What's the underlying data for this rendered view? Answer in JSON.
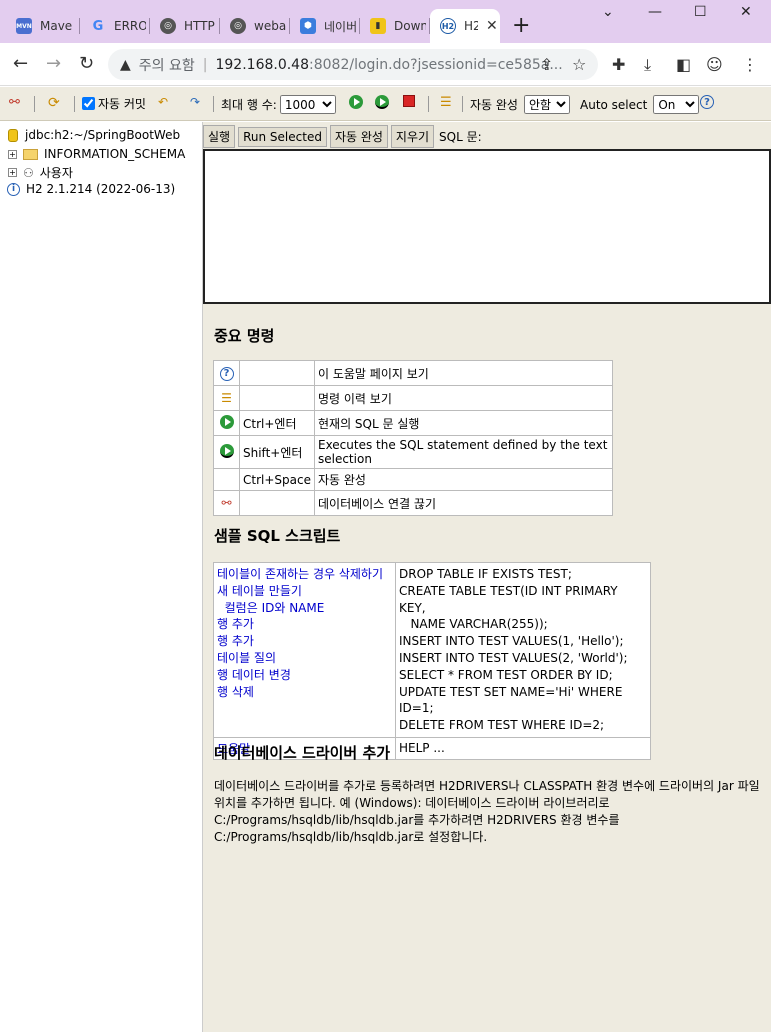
{
  "browser": {
    "tabs": [
      {
        "label": "Maven",
        "favicon": "maven-favicon"
      },
      {
        "label": "ERROR",
        "favicon": "google-favicon"
      },
      {
        "label": "HTTP",
        "favicon": "globe-favicon"
      },
      {
        "label": "webapp",
        "favicon": "globe-favicon"
      },
      {
        "label": "네이버",
        "favicon": "hex-favicon"
      },
      {
        "label": "Download",
        "favicon": "doc-favicon"
      },
      {
        "label": "H2",
        "favicon": "h2-favicon"
      }
    ],
    "address": {
      "warning": "주의 요함",
      "host": "192.168.0.48",
      "path": ":8082/login.do?jsessionid=ce585a..."
    }
  },
  "toolbar": {
    "autocommit_label": "자동 커밋",
    "maxrows_label": "최대 행 수:",
    "maxrows_value": "1000",
    "autocomplete_label": "자동 완성",
    "autocomplete_value": "안함",
    "autoselect_label": "Auto select",
    "autoselect_value": "On"
  },
  "tree": {
    "connection": "jdbc:h2:~/SpringBootWeb",
    "schema": "INFORMATION_SCHEMA",
    "users": "사용자",
    "version": "H2 2.1.214 (2022-06-13)"
  },
  "main": {
    "buttons": {
      "run": "실행",
      "run_selected": "Run Selected",
      "autocomplete": "자동 완성",
      "clear": "지우기"
    },
    "sql_label": "SQL 문:",
    "important_title": "중요 명령",
    "commands": [
      {
        "key": "",
        "desc": "이 도움말 페이지 보기"
      },
      {
        "key": "",
        "desc": "명령 이력 보기"
      },
      {
        "key": "Ctrl+엔터",
        "desc": "현재의 SQL 문 실행"
      },
      {
        "key": "Shift+엔터",
        "desc": "Executes the SQL statement defined by the text selection"
      },
      {
        "key": "Ctrl+Space",
        "desc": "자동 완성"
      },
      {
        "key": "",
        "desc": "데이터베이스 연결 끊기"
      }
    ],
    "sample_title": "샘플 SQL 스크립트",
    "samples": [
      {
        "label": "테이블이 존재하는 경우 삭제하기",
        "sql": "DROP TABLE IF EXISTS TEST;"
      },
      {
        "label": "새 테이블 만들기",
        "sql": "CREATE TABLE TEST(ID INT PRIMARY KEY,"
      },
      {
        "label": "  컬럼은 ID와 NAME",
        "sql": "   NAME VARCHAR(255));"
      },
      {
        "label": "행 추가",
        "sql": "INSERT INTO TEST VALUES(1, 'Hello');"
      },
      {
        "label": "행 추가",
        "sql": "INSERT INTO TEST VALUES(2, 'World');"
      },
      {
        "label": "테이블 질의",
        "sql": "SELECT * FROM TEST ORDER BY ID;"
      },
      {
        "label": "행 데이터 변경",
        "sql": "UPDATE TEST SET NAME='Hi' WHERE ID=1;"
      },
      {
        "label": "행 삭제",
        "sql": "DELETE FROM TEST WHERE ID=2;"
      }
    ],
    "help_label": "도움말",
    "help_sql": "HELP ...",
    "driver_title": "데이터베이스 드라이버 추가",
    "driver_text": "데이터베이스 드라이버를 추가로 등록하려면 H2DRIVERS나 CLASSPATH 환경 변수에 드라이버의 Jar 파일 위치를 추가하면 됩니다. 예 (Windows): 데이터베이스 드라이버 라이브러리로 C:/Programs/hsqldb/lib/hsqldb.jar를 추가하려면 H2DRIVERS 환경 변수를 C:/Programs/hsqldb/lib/hsqldb.jar로 설정합니다."
  }
}
